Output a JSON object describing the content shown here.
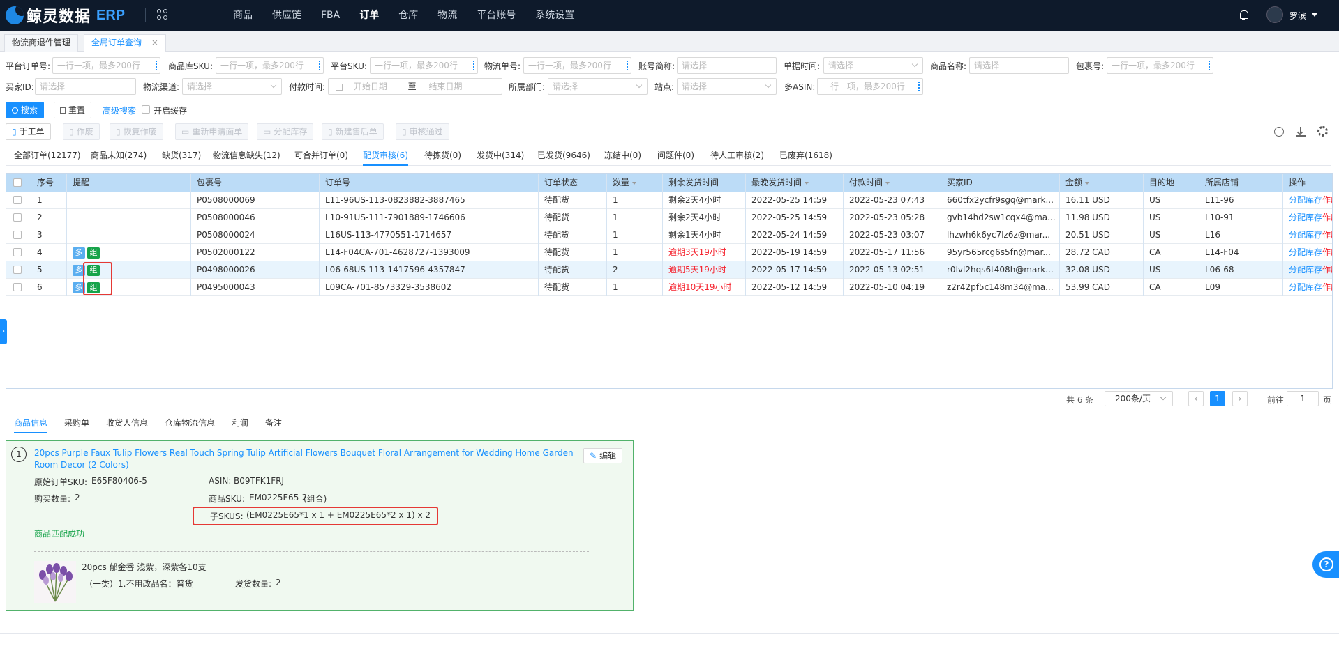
{
  "app": {
    "logo_text": "鲸灵数据",
    "logo_suffix": "ERP"
  },
  "nav": [
    "商品",
    "供应链",
    "FBA",
    "订单",
    "仓库",
    "物流",
    "平台账号",
    "系统设置"
  ],
  "nav_active": "订单",
  "user": {
    "name": "罗滨"
  },
  "page_tabs": [
    {
      "label": "物流商退件管理",
      "active": false
    },
    {
      "label": "全局订单查询",
      "active": true,
      "close": "×"
    }
  ],
  "filters": {
    "platform_order_no": {
      "label": "平台订单号:",
      "placeholder": "一行一项，最多200行"
    },
    "product_sku": {
      "label": "商品库SKU:",
      "placeholder": "一行一项，最多200行"
    },
    "platform_sku": {
      "label": "平台SKU:",
      "placeholder": "一行一项，最多200行"
    },
    "logistics_no": {
      "label": "物流单号:",
      "placeholder": "一行一项，最多200行"
    },
    "account_short": {
      "label": "账号简称:",
      "placeholder": "请选择"
    },
    "doc_time": {
      "label": "单据时间:",
      "placeholder": "请选择"
    },
    "product_name": {
      "label": "商品名称:",
      "placeholder": "请选择"
    },
    "package_no": {
      "label": "包裹号:",
      "placeholder": "一行一项，最多200行"
    },
    "buyer_id": {
      "label": "买家ID:",
      "placeholder": "请选择"
    },
    "logistics_channel": {
      "label": "物流渠道:",
      "placeholder": "请选择"
    },
    "pay_time": {
      "label": "付款时间:",
      "start": "开始日期",
      "to": "至",
      "end": "结束日期"
    },
    "department": {
      "label": "所属部门:",
      "placeholder": "请选择"
    },
    "site": {
      "label": "站点:",
      "placeholder": "请选择"
    },
    "multi_asin": {
      "label": "多ASIN:",
      "placeholder": "一行一项，最多200行"
    }
  },
  "actions": {
    "search": "搜索",
    "reset": "重置",
    "advanced": "高级搜索",
    "cache": "开启缓存",
    "manual": "手工单",
    "void": "作废",
    "restore": "恢复作废",
    "reapply": "重新申请面单",
    "allocate": "分配库存",
    "after_sale": "新建售后单",
    "approve": "审核通过"
  },
  "status_tabs": [
    "全部订单(12177)",
    "商品未知(274)",
    "缺货(317)",
    "物流信息缺失(12)",
    "可合并订单(0)",
    "配货审核(6)",
    "待拣货(0)",
    "发货中(314)",
    "已发货(9646)",
    "冻结中(0)",
    "问题件(0)",
    "待人工审核(2)",
    "已废弃(1618)"
  ],
  "status_tab_active": 5,
  "table": {
    "columns": [
      "序号",
      "提醒",
      "包裹号",
      "订单号",
      "订单状态",
      "数量",
      "剩余发货时间",
      "最晚发货时间",
      "付款时间",
      "买家ID",
      "金额",
      "目的地",
      "所属店铺",
      "操作"
    ],
    "rows": [
      {
        "idx": "1",
        "tags": [],
        "package": "P0508000069",
        "order": "L11-96US-113-0823882-3887465",
        "status": "待配货",
        "qty": "1",
        "remain": "剩余2天4小时",
        "overdue": false,
        "latest": "2022-05-25 14:59",
        "paid": "2022-05-23 07:43",
        "buyer": "660tfx2ycfr9sgq@mark...",
        "amount": "16.11 USD",
        "dest": "US",
        "store": "L11-96",
        "op1": "分配库存",
        "op2": "作废"
      },
      {
        "idx": "2",
        "tags": [],
        "package": "P0508000046",
        "order": "L10-91US-111-7901889-1746606",
        "status": "待配货",
        "qty": "1",
        "remain": "剩余2天4小时",
        "overdue": false,
        "latest": "2022-05-25 14:59",
        "paid": "2022-05-23 05:28",
        "buyer": "gvb14hd2sw1cqx4@ma...",
        "amount": "11.98 USD",
        "dest": "US",
        "store": "L10-91",
        "op1": "分配库存",
        "op2": "作废"
      },
      {
        "idx": "3",
        "tags": [],
        "package": "P0508000024",
        "order": "L16US-113-4770551-1714657",
        "status": "待配货",
        "qty": "1",
        "remain": "剩余1天4小时",
        "overdue": false,
        "latest": "2022-05-24 14:59",
        "paid": "2022-05-23 03:07",
        "buyer": "lhzwh6k6yc7lz6z@mar...",
        "amount": "20.51 USD",
        "dest": "US",
        "store": "L16",
        "op1": "分配库存",
        "op2": "作废"
      },
      {
        "idx": "4",
        "tags": [
          "多",
          "组"
        ],
        "package": "P0502000122",
        "order": "L14-F04CA-701-4628727-1393009",
        "status": "待配货",
        "qty": "1",
        "remain": "逾期3天19小时",
        "overdue": true,
        "latest": "2022-05-19 14:59",
        "paid": "2022-05-17 11:56",
        "buyer": "95yr565rcg6s5fn@mar...",
        "amount": "28.72 CAD",
        "dest": "CA",
        "store": "L14-F04",
        "op1": "分配库存",
        "op2": "作废"
      },
      {
        "idx": "5",
        "tags": [
          "多",
          "组"
        ],
        "package": "P0498000026",
        "order": "L06-68US-113-1417596-4357847",
        "status": "待配货",
        "qty": "2",
        "remain": "逾期5天19小时",
        "overdue": true,
        "latest": "2022-05-17 14:59",
        "paid": "2022-05-13 02:51",
        "buyer": "r0lvl2hqs6t408h@mark...",
        "amount": "32.08 USD",
        "dest": "US",
        "store": "L06-68",
        "op1": "分配库存",
        "op2": "作废"
      },
      {
        "idx": "6",
        "tags": [
          "多",
          "组"
        ],
        "package": "P0495000043",
        "order": "L09CA-701-8573329-3538602",
        "status": "待配货",
        "qty": "1",
        "remain": "逾期10天19小时",
        "overdue": true,
        "latest": "2022-05-12 14:59",
        "paid": "2022-05-10 04:19",
        "buyer": "z2r42pf5c148m34@ma...",
        "amount": "53.99 CAD",
        "dest": "CA",
        "store": "L09",
        "op1": "分配库存",
        "op2": "作废"
      }
    ]
  },
  "pagination": {
    "total": "共 6 条",
    "page_size": "200条/页",
    "current": "1",
    "goto_label": "前往",
    "goto_value": "1",
    "page_unit": "页"
  },
  "detail_tabs": [
    "商品信息",
    "采购单",
    "收货人信息",
    "仓库物流信息",
    "利润",
    "备注"
  ],
  "detail": {
    "index": "1",
    "title": "20pcs Purple Faux Tulip Flowers Real Touch Spring Tulip Artificial Flowers Bouquet Floral Arrangement for Wedding Home Garden Room Decor (2 Colors)",
    "edit": "编辑",
    "orig_sku_label": "原始订单SKU:",
    "orig_sku": "E65F80406-5",
    "asin_label": "ASIN:",
    "asin": "B09TFK1FRJ",
    "buy_qty_label": "购买数量:",
    "buy_qty": "2",
    "prod_sku_label": "商品SKU:",
    "prod_sku": "EM0225E65-2",
    "combo": "(组合)",
    "sub_skus_label": "子SKUS:",
    "sub_skus": "(EM0225E65*1 x 1 + EM0225E65*2 x 1) x 2",
    "match": "商品匹配成功",
    "item_name": "20pcs 郁金香 浅紫，深紫各10支",
    "item_cat": "（一类）1.不用改品名：普货",
    "ship_qty_label": "发货数量:",
    "ship_qty": "2"
  },
  "colors": {
    "topbar": "#0e1a2b",
    "accent": "#1890ff",
    "header_row": "#bcdcf7",
    "danger": "#f5222d",
    "success": "#16a34a"
  }
}
